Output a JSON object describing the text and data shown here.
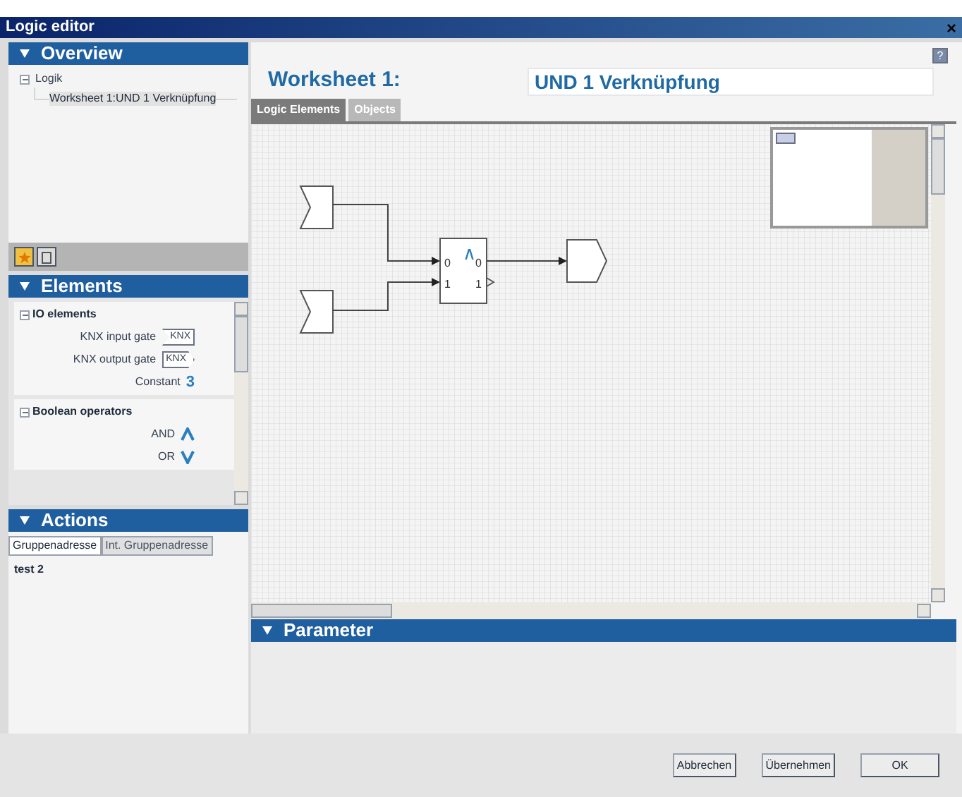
{
  "window": {
    "title": "Logic editor",
    "close": "×",
    "help": "?"
  },
  "overview": {
    "title": "Overview",
    "tree": [
      {
        "label": "Logik",
        "expanded": true,
        "children": [
          {
            "label": "Worksheet 1:UND 1 Verknüpfung",
            "selected": true
          }
        ]
      }
    ]
  },
  "elements": {
    "title": "Elements",
    "groups": [
      {
        "label": "IO elements",
        "expanded": true,
        "items": [
          {
            "label": "KNX input gate",
            "kind": "input",
            "symbol": "KNX"
          },
          {
            "label": "KNX output gate",
            "kind": "output",
            "symbol": "KNX"
          },
          {
            "label": "Constant",
            "kind": "constant",
            "symbol": "3"
          }
        ]
      },
      {
        "label": "Boolean operators",
        "expanded": true,
        "items": [
          {
            "label": "AND",
            "kind": "and"
          },
          {
            "label": "OR",
            "kind": "or"
          }
        ]
      }
    ]
  },
  "actions": {
    "title": "Actions",
    "tabs": [
      {
        "label": "Gruppenadresse",
        "selected": true
      },
      {
        "label": "Int. Gruppenadresse",
        "selected": false
      }
    ],
    "items": [
      "test 2"
    ]
  },
  "worksheet": {
    "label": "Worksheet 1:",
    "name": "UND 1 Verknüpfung",
    "tabs": [
      {
        "label": "Logic Elements",
        "selected": true
      },
      {
        "label": "Objects",
        "selected": false
      }
    ]
  },
  "diagram": {
    "gate": {
      "symbol": "∧",
      "inputs": [
        "0",
        "1"
      ],
      "outputs": [
        "0",
        "1"
      ]
    }
  },
  "parameter": {
    "title": "Parameter"
  },
  "buttons": [
    "Abbrechen",
    "Übernehmen",
    "OK"
  ]
}
